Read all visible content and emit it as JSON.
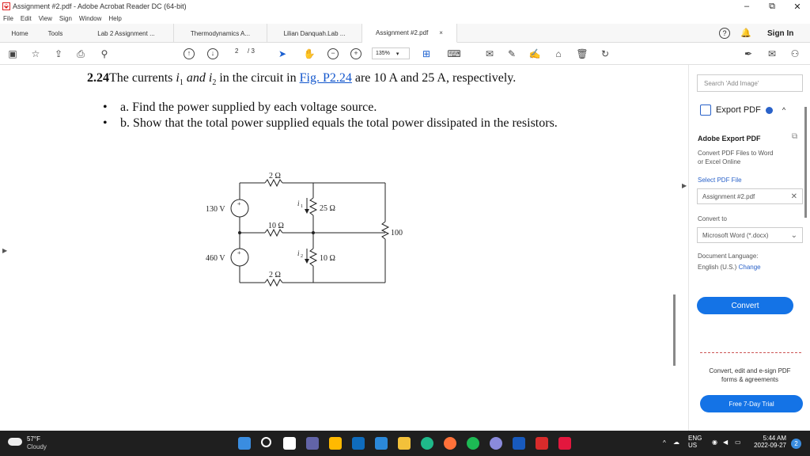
{
  "window": {
    "title": "Assignment #2.pdf - Adobe Acrobat Reader DC (64-bit)"
  },
  "menu": [
    "File",
    "Edit",
    "View",
    "Sign",
    "Window",
    "Help"
  ],
  "tabs": [
    {
      "label": "Home"
    },
    {
      "label": "Tools"
    },
    {
      "label": "Lab 2 Assignment ..."
    },
    {
      "label": "Thermodynamics A..."
    },
    {
      "label": "Lilian Danquah.Lab ..."
    },
    {
      "label": "Assignment #2.pdf"
    }
  ],
  "sign_in": "Sign In",
  "toolbar": {
    "page_current": "2",
    "page_total": "/ 3",
    "zoom": "135%"
  },
  "question": {
    "number": "2.24",
    "text_before": "The currents ",
    "i1": "i",
    "i1_sub": "1",
    "and": " and ",
    "i2": "i",
    "i2_sub": "2",
    "text_mid": " in the circuit in ",
    "link": "Fig. P2.24",
    "text_after": " are 10 A and 25 A, respectively.",
    "part_a": "a. Find the power supplied by each voltage source.",
    "part_b": "b. Show that the total power supplied equals the total power dissipated in the resistors."
  },
  "circuit": {
    "r_top": "2 Ω",
    "r_25": "25 Ω",
    "r_mid": "10 Ω",
    "r_100": "100 Ω",
    "r_10": "10 Ω",
    "r_bot": "2 Ω",
    "v1": "130 V",
    "v2": "460 V",
    "i1": "i",
    "i1_sub": "1",
    "i2": "i",
    "i2_sub": "2",
    "plus": "+"
  },
  "sidebar": {
    "search_placeholder": "Search 'Add Image'",
    "export_label": "Export PDF",
    "title": "Adobe Export PDF",
    "desc_1": "Convert PDF Files to Word",
    "desc_2": "or Excel Online",
    "select_label": "Select PDF File",
    "file": "Assignment #2.pdf",
    "convert_to": "Convert to",
    "format": "Microsoft Word (*.docx)",
    "lang_label": "Document Language:",
    "lang_value": "English (U.S.)",
    "lang_change": "Change",
    "convert_btn": "Convert",
    "promo_1": "Convert, edit and e-sign PDF",
    "promo_2": "forms & agreements",
    "trial_btn": "Free 7-Day Trial"
  },
  "taskbar": {
    "temp": "57°F",
    "weather": "Cloudy",
    "lang": "ENG",
    "region": "US",
    "time": "5:44 AM",
    "date": "2022-09-27",
    "notifications": "2"
  }
}
